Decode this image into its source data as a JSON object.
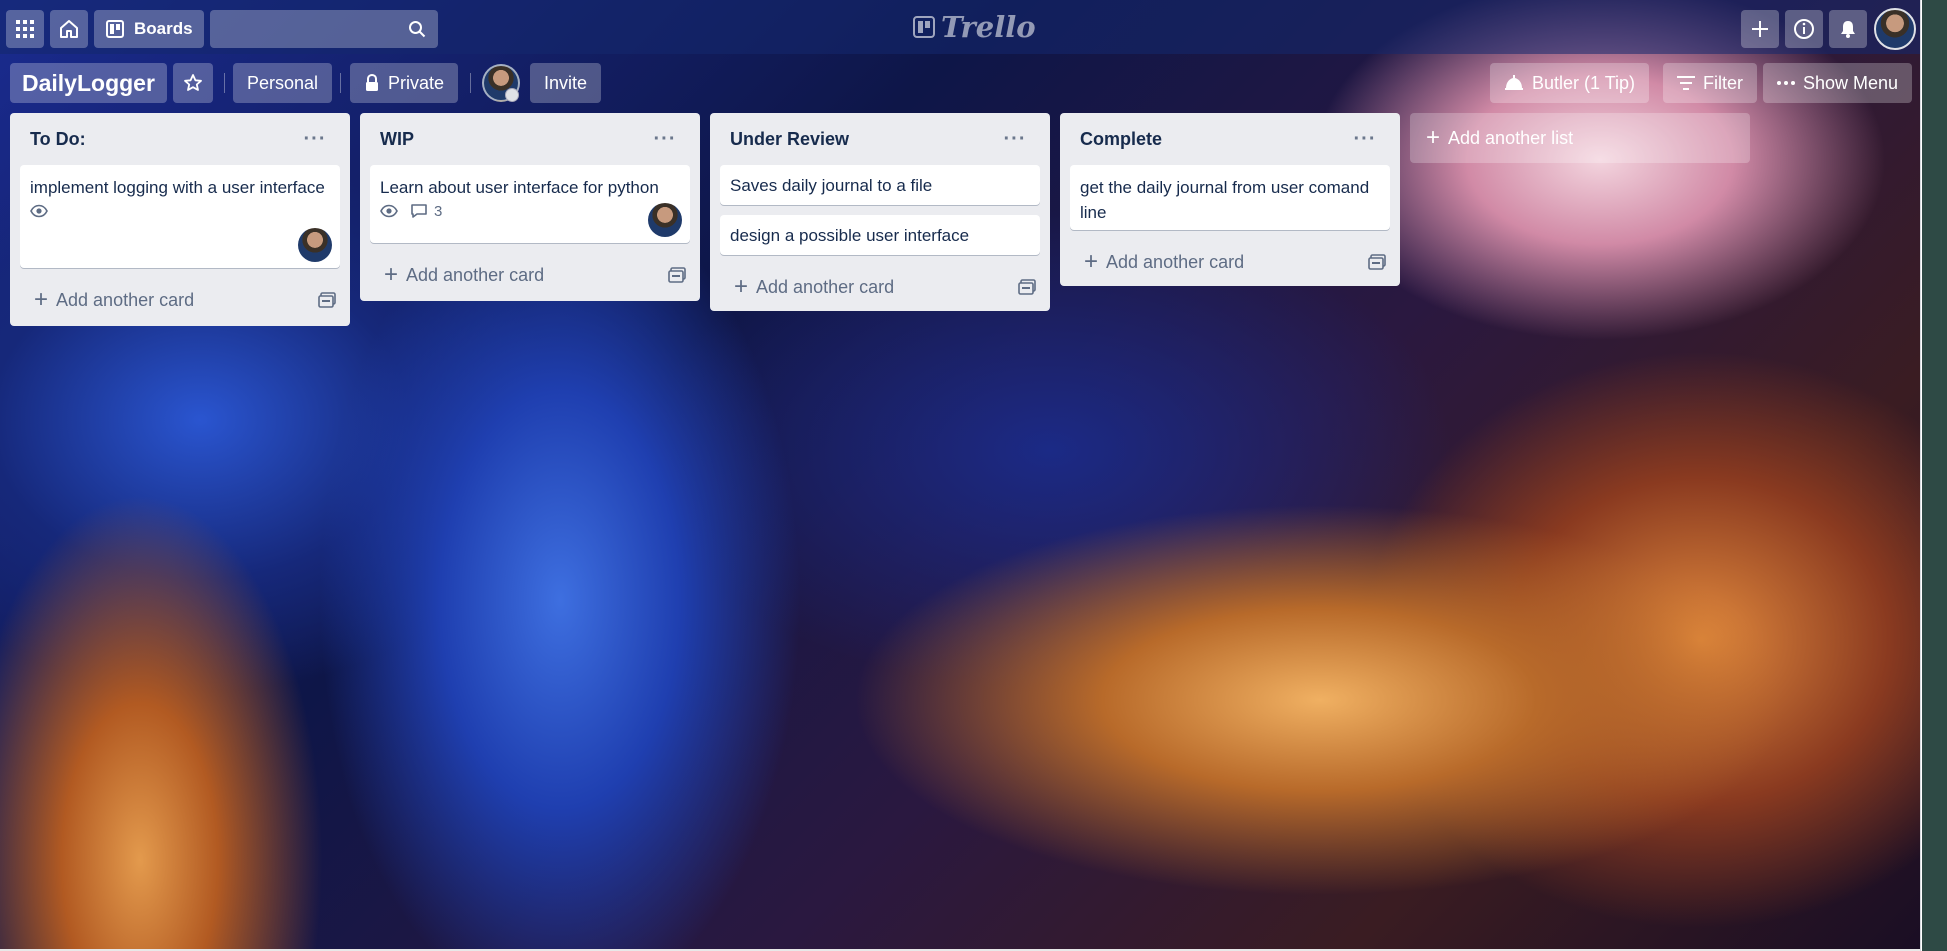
{
  "header": {
    "boards_label": "Boards",
    "search_value": "",
    "logo_text": "Trello"
  },
  "board": {
    "title": "DailyLogger",
    "personal_label": "Personal",
    "private_label": "Private",
    "invite_label": "Invite",
    "butler_label": "Butler (1 Tip)",
    "filter_label": "Filter",
    "show_menu_label": "Show Menu"
  },
  "lists": [
    {
      "title": "To Do:",
      "cards": [
        {
          "text": "implement logging with a user interface",
          "watching": true
        }
      ],
      "add_card_label": "Add another card"
    },
    {
      "title": "WIP",
      "cards": [
        {
          "text": "Learn about user interface for python",
          "watching": true,
          "comments": "3"
        }
      ],
      "add_card_label": "Add another card"
    },
    {
      "title": "Under Review",
      "cards": [
        {
          "text": "Saves daily journal to a file"
        },
        {
          "text": "design a possible user interface"
        }
      ],
      "add_card_label": "Add another card"
    },
    {
      "title": "Complete",
      "cards": [
        {
          "text": "get the daily journal from user comand line"
        }
      ],
      "add_card_label": "Add another card"
    }
  ],
  "add_list_label": "Add another list",
  "list_menu_glyph": "···",
  "colors": {
    "list_bg": "#ebecf0",
    "card_text": "#172b4d",
    "muted_text": "#5e6c84"
  }
}
